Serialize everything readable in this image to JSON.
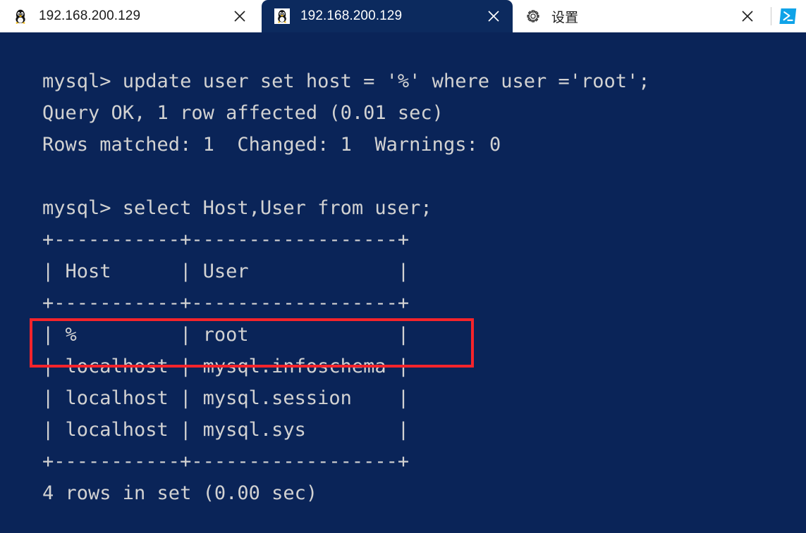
{
  "window": {
    "background_color": "#0a2458",
    "tabbar_background": "#ffffff"
  },
  "tabbar": {
    "tabs": [
      {
        "id": "tab-ssh-1",
        "title": "192.168.200.129",
        "icon": "tux-linux-icon",
        "active": false,
        "close_label": "×"
      },
      {
        "id": "tab-ssh-2",
        "title": "192.168.200.129",
        "icon": "tux-linux-icon",
        "active": true,
        "close_label": "×"
      },
      {
        "id": "tab-settings",
        "title": "设置",
        "icon": "gear-icon",
        "active": false,
        "close_label": "×"
      }
    ],
    "new_tab_button": {
      "icon": "powershell-icon",
      "color": "#0fa3e8"
    }
  },
  "terminal": {
    "foreground_color": "#d2d2d2",
    "background_color": "#0a2458",
    "lines": [
      "mysql> update user set host = '%' where user ='root';",
      "Query OK, 1 row affected (0.01 sec)",
      "Rows matched: 1  Changed: 1  Warnings: 0",
      "",
      "mysql> select Host,User from user;",
      "+-----------+------------------+",
      "| Host      | User             |",
      "+-----------+------------------+",
      "| %         | root             |",
      "| localhost | mysql.infoschema |",
      "| localhost | mysql.session    |",
      "| localhost | mysql.sys        |",
      "+-----------+------------------+",
      "4 rows in set (0.00 sec)"
    ]
  },
  "annotation": {
    "highlight_color": "#f5242b",
    "highlighted_row": "| %         | root             |"
  }
}
